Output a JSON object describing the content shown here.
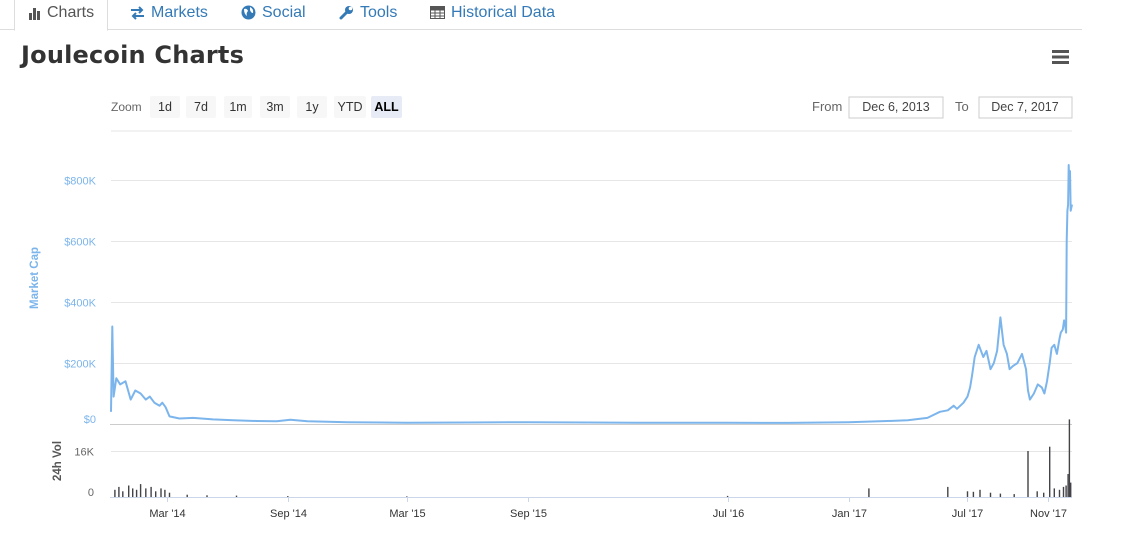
{
  "tabs": [
    {
      "label": "Charts",
      "icon": "bar-chart-icon",
      "active": true
    },
    {
      "label": "Markets",
      "icon": "exchange-arrows-icon",
      "active": false
    },
    {
      "label": "Social",
      "icon": "globe-icon",
      "active": false
    },
    {
      "label": "Tools",
      "icon": "wrench-icon",
      "active": false
    },
    {
      "label": "Historical Data",
      "icon": "table-icon",
      "active": false
    }
  ],
  "page": {
    "title": "Joulecoin Charts"
  },
  "colors": {
    "accent": "#337ab7",
    "line": "#7cb5ec",
    "volume": "#434348",
    "grid": "#e6e6e6",
    "axis_text": "#666666"
  },
  "range_selector": {
    "zoom_label": "Zoom",
    "buttons": [
      "1d",
      "7d",
      "1m",
      "3m",
      "1y",
      "YTD",
      "ALL"
    ],
    "selected": "ALL",
    "from_label": "From",
    "from_value": "Dec 6, 2013",
    "to_label": "To",
    "to_value": "Dec 7, 2017"
  },
  "chart_data": [
    {
      "type": "line",
      "ylabel": "Market Cap",
      "ylim": [
        0,
        850000
      ],
      "yticks": [
        0,
        200000,
        400000,
        600000,
        800000
      ],
      "ytick_labels": [
        "$0",
        "$200K",
        "$400K",
        "$600K",
        "$800K"
      ],
      "grid": true,
      "xticks": [
        "2014-03-01",
        "2014-09-01",
        "2015-03-01",
        "2015-09-01",
        "2016-07-01",
        "2017-01-01",
        "2017-07-01",
        "2017-11-01"
      ],
      "xtick_labels": [
        "Mar '14",
        "Sep '14",
        "Mar '15",
        "Sep '15",
        "Jul '16",
        "Jan '17",
        "Jul '17",
        "Nov '17"
      ],
      "xlim": [
        "2013-12-06",
        "2017-12-07"
      ],
      "x": [
        "2013-12-06",
        "2013-12-08",
        "2013-12-10",
        "2013-12-14",
        "2013-12-20",
        "2013-12-28",
        "2014-01-05",
        "2014-01-12",
        "2014-01-20",
        "2014-01-28",
        "2014-02-03",
        "2014-02-10",
        "2014-02-18",
        "2014-02-22",
        "2014-02-27",
        "2014-03-05",
        "2014-03-20",
        "2014-04-10",
        "2014-05-10",
        "2014-06-10",
        "2014-07-15",
        "2014-08-15",
        "2014-09-05",
        "2014-10-01",
        "2014-12-01",
        "2015-03-01",
        "2015-06-01",
        "2015-09-01",
        "2015-12-01",
        "2016-03-01",
        "2016-07-01",
        "2016-10-01",
        "2017-01-01",
        "2017-03-01",
        "2017-04-01",
        "2017-05-01",
        "2017-05-20",
        "2017-06-01",
        "2017-06-10",
        "2017-06-15",
        "2017-06-25",
        "2017-07-01",
        "2017-07-05",
        "2017-07-08",
        "2017-07-12",
        "2017-07-18",
        "2017-07-25",
        "2017-07-30",
        "2017-08-05",
        "2017-08-10",
        "2017-08-15",
        "2017-08-20",
        "2017-08-25",
        "2017-08-30",
        "2017-09-03",
        "2017-09-08",
        "2017-09-15",
        "2017-09-22",
        "2017-09-28",
        "2017-10-01",
        "2017-10-04",
        "2017-10-10",
        "2017-10-16",
        "2017-10-22",
        "2017-10-26",
        "2017-10-30",
        "2017-11-03",
        "2017-11-06",
        "2017-11-10",
        "2017-11-14",
        "2017-11-18",
        "2017-11-20",
        "2017-11-23",
        "2017-11-25",
        "2017-11-27",
        "2017-11-28",
        "2017-11-29",
        "2017-11-30",
        "2017-12-01",
        "2017-12-02",
        "2017-12-03",
        "2017-12-04",
        "2017-12-05",
        "2017-12-07"
      ],
      "y": [
        40000,
        320000,
        90000,
        150000,
        130000,
        140000,
        80000,
        110000,
        100000,
        80000,
        90000,
        70000,
        60000,
        70000,
        55000,
        25000,
        18000,
        20000,
        15000,
        12000,
        10000,
        9000,
        14000,
        9000,
        6000,
        4000,
        5000,
        6000,
        5000,
        4000,
        4000,
        3500,
        6000,
        10000,
        12000,
        20000,
        40000,
        45000,
        60000,
        50000,
        70000,
        90000,
        120000,
        160000,
        220000,
        260000,
        220000,
        240000,
        180000,
        200000,
        240000,
        350000,
        260000,
        230000,
        180000,
        190000,
        200000,
        230000,
        180000,
        110000,
        80000,
        100000,
        130000,
        120000,
        100000,
        140000,
        200000,
        250000,
        260000,
        230000,
        280000,
        300000,
        310000,
        340000,
        320000,
        300000,
        600000,
        700000,
        720000,
        850000,
        780000,
        830000,
        700000,
        720000
      ]
    },
    {
      "type": "bar",
      "ylabel": "24h Vol",
      "ylim": [
        0,
        24000
      ],
      "yticks": [
        0,
        16000
      ],
      "ytick_labels": [
        "0",
        "16K"
      ],
      "x": [
        "2013-12-12",
        "2013-12-18",
        "2013-12-24",
        "2014-01-02",
        "2014-01-08",
        "2014-01-14",
        "2014-01-20",
        "2014-01-28",
        "2014-02-05",
        "2014-02-12",
        "2014-02-20",
        "2014-02-26",
        "2014-03-05",
        "2014-04-01",
        "2014-05-01",
        "2014-06-15",
        "2014-09-01",
        "2015-03-01",
        "2016-07-01",
        "2017-02-01",
        "2017-06-01",
        "2017-07-01",
        "2017-07-10",
        "2017-07-20",
        "2017-08-05",
        "2017-08-20",
        "2017-09-10",
        "2017-10-01",
        "2017-10-15",
        "2017-10-25",
        "2017-11-03",
        "2017-11-10",
        "2017-11-18",
        "2017-11-24",
        "2017-11-28",
        "2017-12-01",
        "2017-12-03",
        "2017-12-05"
      ],
      "values": [
        2500,
        3500,
        2000,
        4000,
        3000,
        2500,
        4500,
        3000,
        3500,
        2000,
        3000,
        2500,
        1500,
        800,
        600,
        500,
        300,
        200,
        400,
        3000,
        3500,
        2000,
        1800,
        2500,
        1500,
        1200,
        1000,
        16000,
        2000,
        1500,
        17500,
        3000,
        2500,
        3500,
        4000,
        8000,
        27000,
        5000
      ]
    }
  ]
}
